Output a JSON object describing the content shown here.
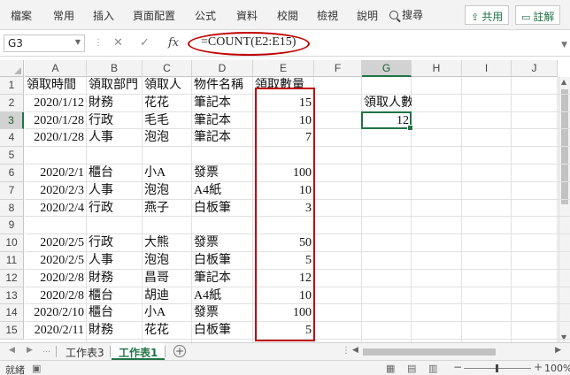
{
  "ribbon": {
    "tabs": [
      "檔案",
      "常用",
      "插入",
      "頁面配置",
      "公式",
      "資料",
      "校閱",
      "檢視",
      "說明"
    ],
    "search_label": "搜尋",
    "share_label": "共用",
    "comment_label": "註解"
  },
  "formula_bar": {
    "name_box": "G3",
    "fx_label": "fx",
    "formula": "=COUNT(E2:E15)"
  },
  "grid": {
    "columns": [
      "A",
      "B",
      "C",
      "D",
      "E",
      "F",
      "G",
      "H",
      "I",
      "J"
    ],
    "rows": [
      "1",
      "2",
      "3",
      "4",
      "5",
      "6",
      "7",
      "8",
      "9",
      "10",
      "11",
      "12",
      "13",
      "14",
      "15"
    ],
    "selected_cell": "G3",
    "header_row": {
      "a": "領取時間",
      "b": "領取部門",
      "c": "領取人",
      "d": "物件名稱",
      "e": "領取數量"
    },
    "records": [
      {
        "row": 2,
        "a": "2020/1/12",
        "b": "財務",
        "c": "花花",
        "d": "筆記本",
        "e": "15"
      },
      {
        "row": 3,
        "a": "2020/1/28",
        "b": "行政",
        "c": "毛毛",
        "d": "筆記本",
        "e": "10"
      },
      {
        "row": 4,
        "a": "2020/1/28",
        "b": "人事",
        "c": "泡泡",
        "d": "筆記本",
        "e": "7"
      },
      {
        "row": 6,
        "a": "2020/2/1",
        "b": "櫃台",
        "c": "小A",
        "d": "發票",
        "e": "100"
      },
      {
        "row": 7,
        "a": "2020/2/3",
        "b": "人事",
        "c": "泡泡",
        "d": "A4紙",
        "e": "10"
      },
      {
        "row": 8,
        "a": "2020/2/4",
        "b": "行政",
        "c": "燕子",
        "d": "白板筆",
        "e": "3"
      },
      {
        "row": 10,
        "a": "2020/2/5",
        "b": "行政",
        "c": "大熊",
        "d": "發票",
        "e": "50"
      },
      {
        "row": 11,
        "a": "2020/2/5",
        "b": "人事",
        "c": "泡泡",
        "d": "白板筆",
        "e": "5"
      },
      {
        "row": 12,
        "a": "2020/2/8",
        "b": "財務",
        "c": "昌哥",
        "d": "筆記本",
        "e": "12"
      },
      {
        "row": 13,
        "a": "2020/2/8",
        "b": "櫃台",
        "c": "胡迪",
        "d": "A4紙",
        "e": "10"
      },
      {
        "row": 14,
        "a": "2020/2/10",
        "b": "櫃台",
        "c": "小A",
        "d": "發票",
        "e": "100"
      },
      {
        "row": 15,
        "a": "2020/2/11",
        "b": "財務",
        "c": "花花",
        "d": "白板筆",
        "e": "5"
      }
    ],
    "g2_label": "領取人數",
    "g3_value": "12"
  },
  "sheet_tabs": [
    "工作表3",
    "工作表1"
  ],
  "active_sheet": "工作表1",
  "status": {
    "ready": "就緒",
    "zoom": "100%"
  },
  "colors": {
    "accent": "#217346",
    "annotation_red": "#c00000"
  }
}
